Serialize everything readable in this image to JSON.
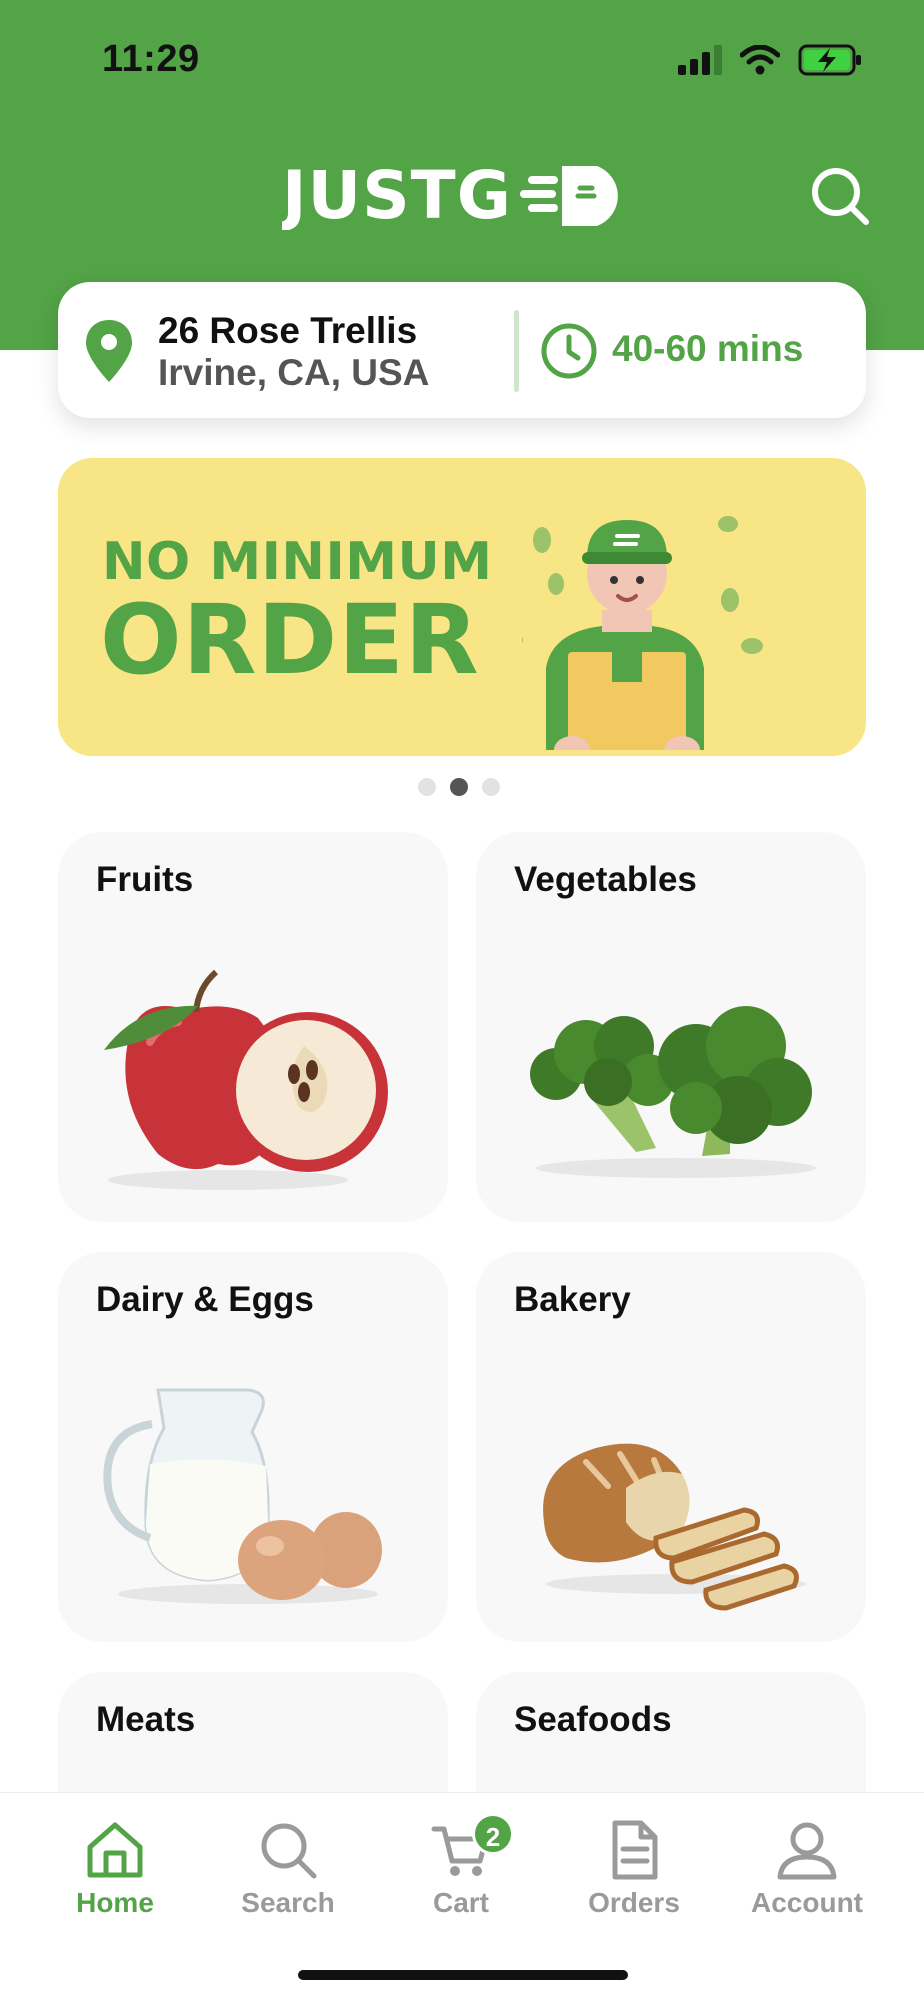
{
  "status_bar": {
    "time": "11:29"
  },
  "header": {
    "logo_text": "JUSTGO",
    "search_icon": "search-icon"
  },
  "location": {
    "address_line1": "26 Rose Trellis",
    "address_line2": "Irvine, CA, USA",
    "eta": "40-60 mins"
  },
  "banner": {
    "line1": "NO MINIMUM",
    "line2": "ORDER",
    "page_count": 3,
    "active_page": 2
  },
  "categories": [
    {
      "label": "Fruits",
      "icon": "apple-image"
    },
    {
      "label": "Vegetables",
      "icon": "broccoli-image"
    },
    {
      "label": "Dairy & Eggs",
      "icon": "milk-eggs-image"
    },
    {
      "label": "Bakery",
      "icon": "bread-image"
    },
    {
      "label": "Meats",
      "icon": "meat-image"
    },
    {
      "label": "Seafoods",
      "icon": "seafood-image"
    }
  ],
  "tabbar": {
    "items": [
      {
        "label": "Home",
        "icon": "home-icon",
        "active": true
      },
      {
        "label": "Search",
        "icon": "search-icon"
      },
      {
        "label": "Cart",
        "icon": "cart-icon",
        "badge": "2"
      },
      {
        "label": "Orders",
        "icon": "document-icon"
      },
      {
        "label": "Account",
        "icon": "user-icon"
      }
    ]
  },
  "colors": {
    "brand_green": "#53A347",
    "banner_yellow": "#F8E585",
    "card_bg": "#F8F8F8"
  }
}
